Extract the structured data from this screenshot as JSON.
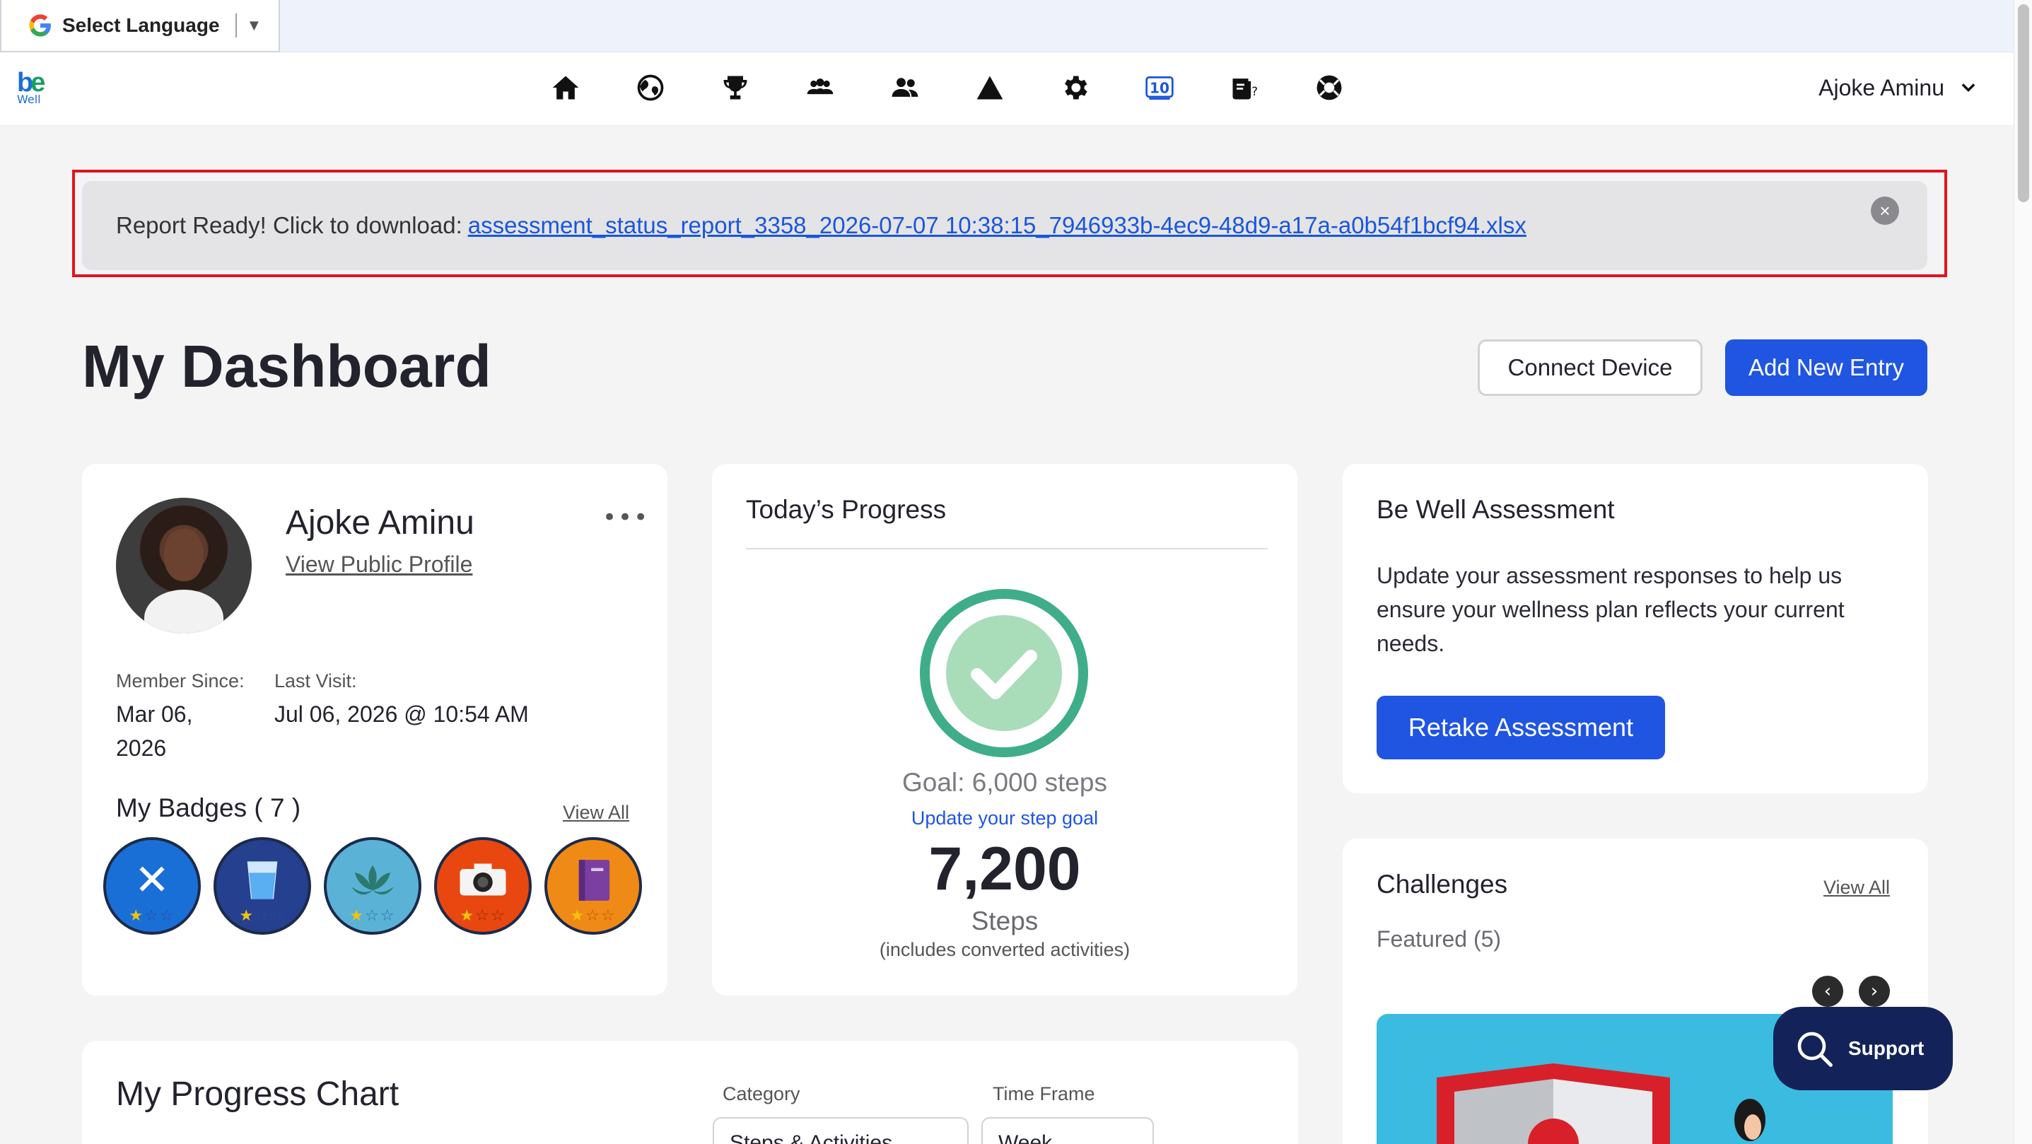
{
  "translate": {
    "label": "Select Language"
  },
  "nav": {
    "icons": [
      "home-icon",
      "globe-icon",
      "trophy-icon",
      "group-icon",
      "users-icon",
      "triangle-icon",
      "gear-icon",
      "ten-badge-icon",
      "quiz-icon",
      "lifebuoy-icon"
    ],
    "ten_badge_text": "10",
    "user_name": "Ajoke Aminu"
  },
  "logo": {
    "text": "be",
    "subtext": "Well"
  },
  "banner": {
    "message": "Report Ready! Click to download:",
    "link_text": "assessment_status_report_3358_2026-07-07 10:38:15_7946933b-4ec9-48d9-a17a-a0b54f1bcf94.xlsx"
  },
  "page": {
    "title": "My Dashboard",
    "connect_device": "Connect Device",
    "add_entry": "Add New Entry"
  },
  "profile": {
    "name": "Ajoke Aminu",
    "public_link": "View Public Profile",
    "member_since_label": "Member Since:",
    "member_since_line1": "Mar 06,",
    "member_since_line2": "2026",
    "last_visit_label": "Last Visit:",
    "last_visit_value": "Jul 06, 2026 @ 10:54 AM",
    "badges_title": "My Badges ( 7 )",
    "badges_view_all": "View All",
    "badges": [
      {
        "name": "dining-badge",
        "color": "#1a6fd6",
        "stars": 1
      },
      {
        "name": "water-badge",
        "color": "#24408e",
        "stars": 1
      },
      {
        "name": "lotus-badge",
        "color": "#5ab3d6",
        "stars": 1
      },
      {
        "name": "camera-badge",
        "color": "#e8470f",
        "stars": 1
      },
      {
        "name": "journal-badge",
        "color": "#f08a17",
        "stars": 1
      }
    ]
  },
  "progress": {
    "title": "Today’s Progress",
    "goal": "Goal: 6,000 steps",
    "update_link": "Update your step goal",
    "steps": "7,200",
    "steps_label": "Steps",
    "steps_note": "(includes converted activities)",
    "ring_color": "#3fae88"
  },
  "assessment": {
    "title": "Be Well Assessment",
    "text": "Update your assessment responses to help us ensure your wellness plan reflects your current needs.",
    "button": "Retake Assessment"
  },
  "challenges": {
    "title": "Challenges",
    "view_all": "View All",
    "featured": "Featured (5)"
  },
  "chart": {
    "title": "My Progress Chart",
    "category_label": "Category",
    "category_value": "Steps & Activities",
    "timeframe_label": "Time Frame",
    "timeframe_value": "Week"
  },
  "support": {
    "label": "Support"
  },
  "colors": {
    "primary": "#1f55e0",
    "banner_border": "#e0141e",
    "support_bg": "#13235a"
  }
}
